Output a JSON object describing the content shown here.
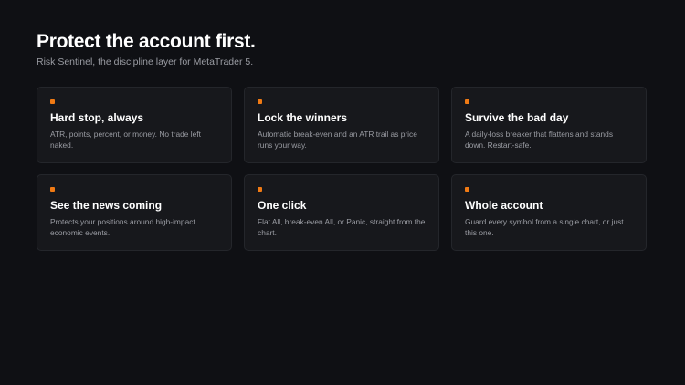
{
  "hero": {
    "title": "Protect the account first.",
    "subtitle": "Risk Sentinel, the discipline layer for MetaTrader 5."
  },
  "theme": {
    "accent": "#f07a14",
    "background": "#0f1014",
    "card_background": "#17181c"
  },
  "features": [
    {
      "title": "Hard stop, always",
      "description": "ATR, points, percent, or money. No trade left naked.",
      "icon": "orange-square-marker"
    },
    {
      "title": "Lock the winners",
      "description": "Automatic break-even and an ATR trail as price runs your way.",
      "icon": "orange-square-marker"
    },
    {
      "title": "Survive the bad day",
      "description": "A daily-loss breaker that flattens and stands down. Restart-safe.",
      "icon": "orange-square-marker"
    },
    {
      "title": "See the news coming",
      "description": "Protects your positions around high-impact economic events.",
      "icon": "orange-square-marker"
    },
    {
      "title": "One click",
      "description": "Flat All, break-even All, or Panic, straight from the chart.",
      "icon": "orange-square-marker"
    },
    {
      "title": "Whole account",
      "description": "Guard every symbol from a single chart, or just this one.",
      "icon": "orange-square-marker"
    }
  ]
}
